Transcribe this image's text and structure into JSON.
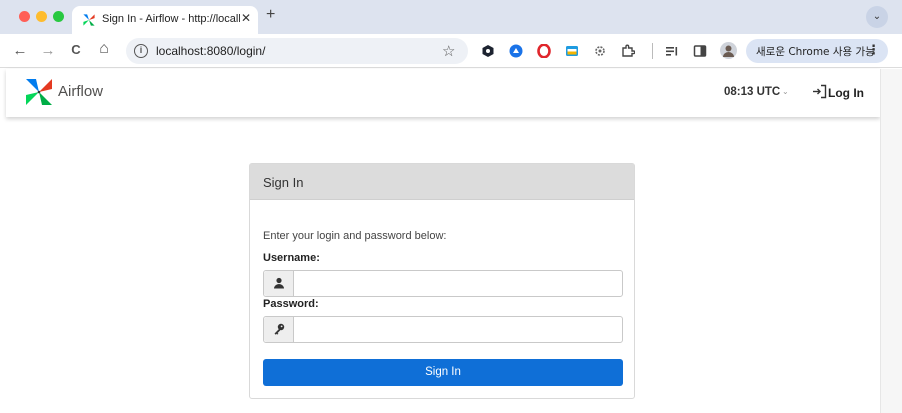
{
  "browser": {
    "tab": {
      "title": "Sign In - Airflow - http://locall",
      "close": "✕"
    },
    "new_tab": "+",
    "tab_menu": "⌄",
    "nav": {
      "back": "←",
      "forward": "→",
      "reload": "C",
      "home": "⌂"
    },
    "omnibox": {
      "info": "i",
      "url": "localhost:8080/login/",
      "star": "☆"
    },
    "chrome_button": {
      "label": "새로운 Chrome 사용 가능",
      "menu": "⋮"
    }
  },
  "navbar": {
    "logo_text": "Airflow",
    "clock": "08:13 UTC",
    "clock_caret": "⌄",
    "login_label": "Log In"
  },
  "signin": {
    "title": "Sign In",
    "instructions": "Enter your login and password below:",
    "username_label": "Username:",
    "username_value": "",
    "password_label": "Password:",
    "password_value": "",
    "button_label": "Sign In"
  },
  "colors": {
    "primary_button": "#0f6fd7",
    "panel_header": "#dcdcdc",
    "tabbar": "#dde3ef"
  }
}
